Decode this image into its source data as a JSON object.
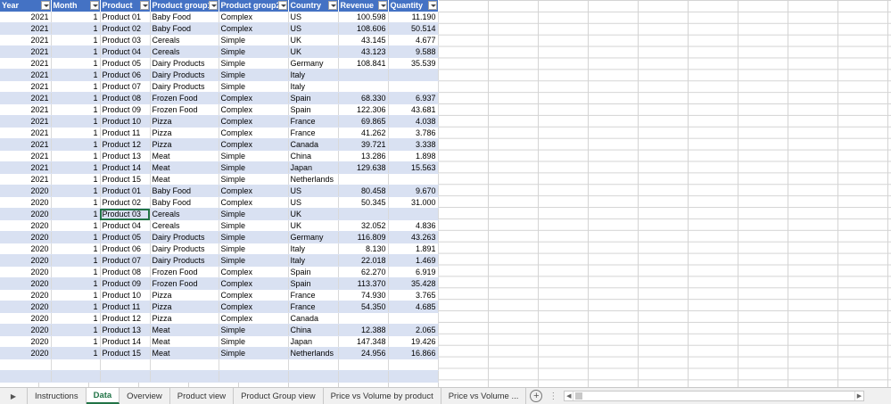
{
  "headers": [
    "Year",
    "Month",
    "Product",
    "Product group1",
    "Product group2",
    "Country",
    "Revenue",
    "Quantity"
  ],
  "rows": [
    [
      "2021",
      "1",
      "Product 01",
      "Baby Food",
      "Complex",
      "US",
      "100.598",
      "11.190"
    ],
    [
      "2021",
      "1",
      "Product 02",
      "Baby Food",
      "Complex",
      "US",
      "108.606",
      "50.514"
    ],
    [
      "2021",
      "1",
      "Product 03",
      "Cereals",
      "Simple",
      "UK",
      "43.145",
      "4.677"
    ],
    [
      "2021",
      "1",
      "Product 04",
      "Cereals",
      "Simple",
      "UK",
      "43.123",
      "9.588"
    ],
    [
      "2021",
      "1",
      "Product 05",
      "Dairy Products",
      "Simple",
      "Germany",
      "108.841",
      "35.539"
    ],
    [
      "2021",
      "1",
      "Product 06",
      "Dairy Products",
      "Simple",
      "Italy",
      "",
      ""
    ],
    [
      "2021",
      "1",
      "Product 07",
      "Dairy Products",
      "Simple",
      "Italy",
      "",
      ""
    ],
    [
      "2021",
      "1",
      "Product 08",
      "Frozen Food",
      "Complex",
      "Spain",
      "68.330",
      "6.937"
    ],
    [
      "2021",
      "1",
      "Product 09",
      "Frozen Food",
      "Complex",
      "Spain",
      "122.306",
      "43.681"
    ],
    [
      "2021",
      "1",
      "Product 10",
      "Pizza",
      "Complex",
      "France",
      "69.865",
      "4.038"
    ],
    [
      "2021",
      "1",
      "Product 11",
      "Pizza",
      "Complex",
      "France",
      "41.262",
      "3.786"
    ],
    [
      "2021",
      "1",
      "Product 12",
      "Pizza",
      "Complex",
      "Canada",
      "39.721",
      "3.338"
    ],
    [
      "2021",
      "1",
      "Product 13",
      "Meat",
      "Simple",
      "China",
      "13.286",
      "1.898"
    ],
    [
      "2021",
      "1",
      "Product 14",
      "Meat",
      "Simple",
      "Japan",
      "129.638",
      "15.563"
    ],
    [
      "2021",
      "1",
      "Product 15",
      "Meat",
      "Simple",
      "Netherlands",
      "",
      ""
    ],
    [
      "2020",
      "1",
      "Product 01",
      "Baby Food",
      "Complex",
      "US",
      "80.458",
      "9.670"
    ],
    [
      "2020",
      "1",
      "Product 02",
      "Baby Food",
      "Complex",
      "US",
      "50.345",
      "31.000"
    ],
    [
      "2020",
      "1",
      "Product 03",
      "Cereals",
      "Simple",
      "UK",
      "",
      ""
    ],
    [
      "2020",
      "1",
      "Product 04",
      "Cereals",
      "Simple",
      "UK",
      "32.052",
      "4.836"
    ],
    [
      "2020",
      "1",
      "Product 05",
      "Dairy Products",
      "Simple",
      "Germany",
      "116.809",
      "43.263"
    ],
    [
      "2020",
      "1",
      "Product 06",
      "Dairy Products",
      "Simple",
      "Italy",
      "8.130",
      "1.891"
    ],
    [
      "2020",
      "1",
      "Product 07",
      "Dairy Products",
      "Simple",
      "Italy",
      "22.018",
      "1.469"
    ],
    [
      "2020",
      "1",
      "Product 08",
      "Frozen Food",
      "Complex",
      "Spain",
      "62.270",
      "6.919"
    ],
    [
      "2020",
      "1",
      "Product 09",
      "Frozen Food",
      "Complex",
      "Spain",
      "113.370",
      "35.428"
    ],
    [
      "2020",
      "1",
      "Product 10",
      "Pizza",
      "Complex",
      "France",
      "74.930",
      "3.765"
    ],
    [
      "2020",
      "1",
      "Product 11",
      "Pizza",
      "Complex",
      "France",
      "54.350",
      "4.685"
    ],
    [
      "2020",
      "1",
      "Product 12",
      "Pizza",
      "Complex",
      "Canada",
      "",
      ""
    ],
    [
      "2020",
      "1",
      "Product 13",
      "Meat",
      "Simple",
      "China",
      "12.388",
      "2.065"
    ],
    [
      "2020",
      "1",
      "Product 14",
      "Meat",
      "Simple",
      "Japan",
      "147.348",
      "19.426"
    ],
    [
      "2020",
      "1",
      "Product 15",
      "Meat",
      "Simple",
      "Netherlands",
      "24.956",
      "16.866"
    ]
  ],
  "selected_cell": {
    "row": 17,
    "col": 2
  },
  "tabs": [
    "Instructions",
    "Data",
    "Overview",
    "Product view",
    "Product Group view",
    "Price vs Volume by product",
    "Price vs Volume ..."
  ],
  "active_tab": "Data",
  "colors": {
    "header_bg": "#4472c4",
    "band": "#d9e1f2",
    "active_tab": "#217346"
  },
  "icons": {
    "prev_sheet": "triangle-right-icon",
    "add_sheet": "plus-circle-icon",
    "more": "ellipsis-icon"
  }
}
